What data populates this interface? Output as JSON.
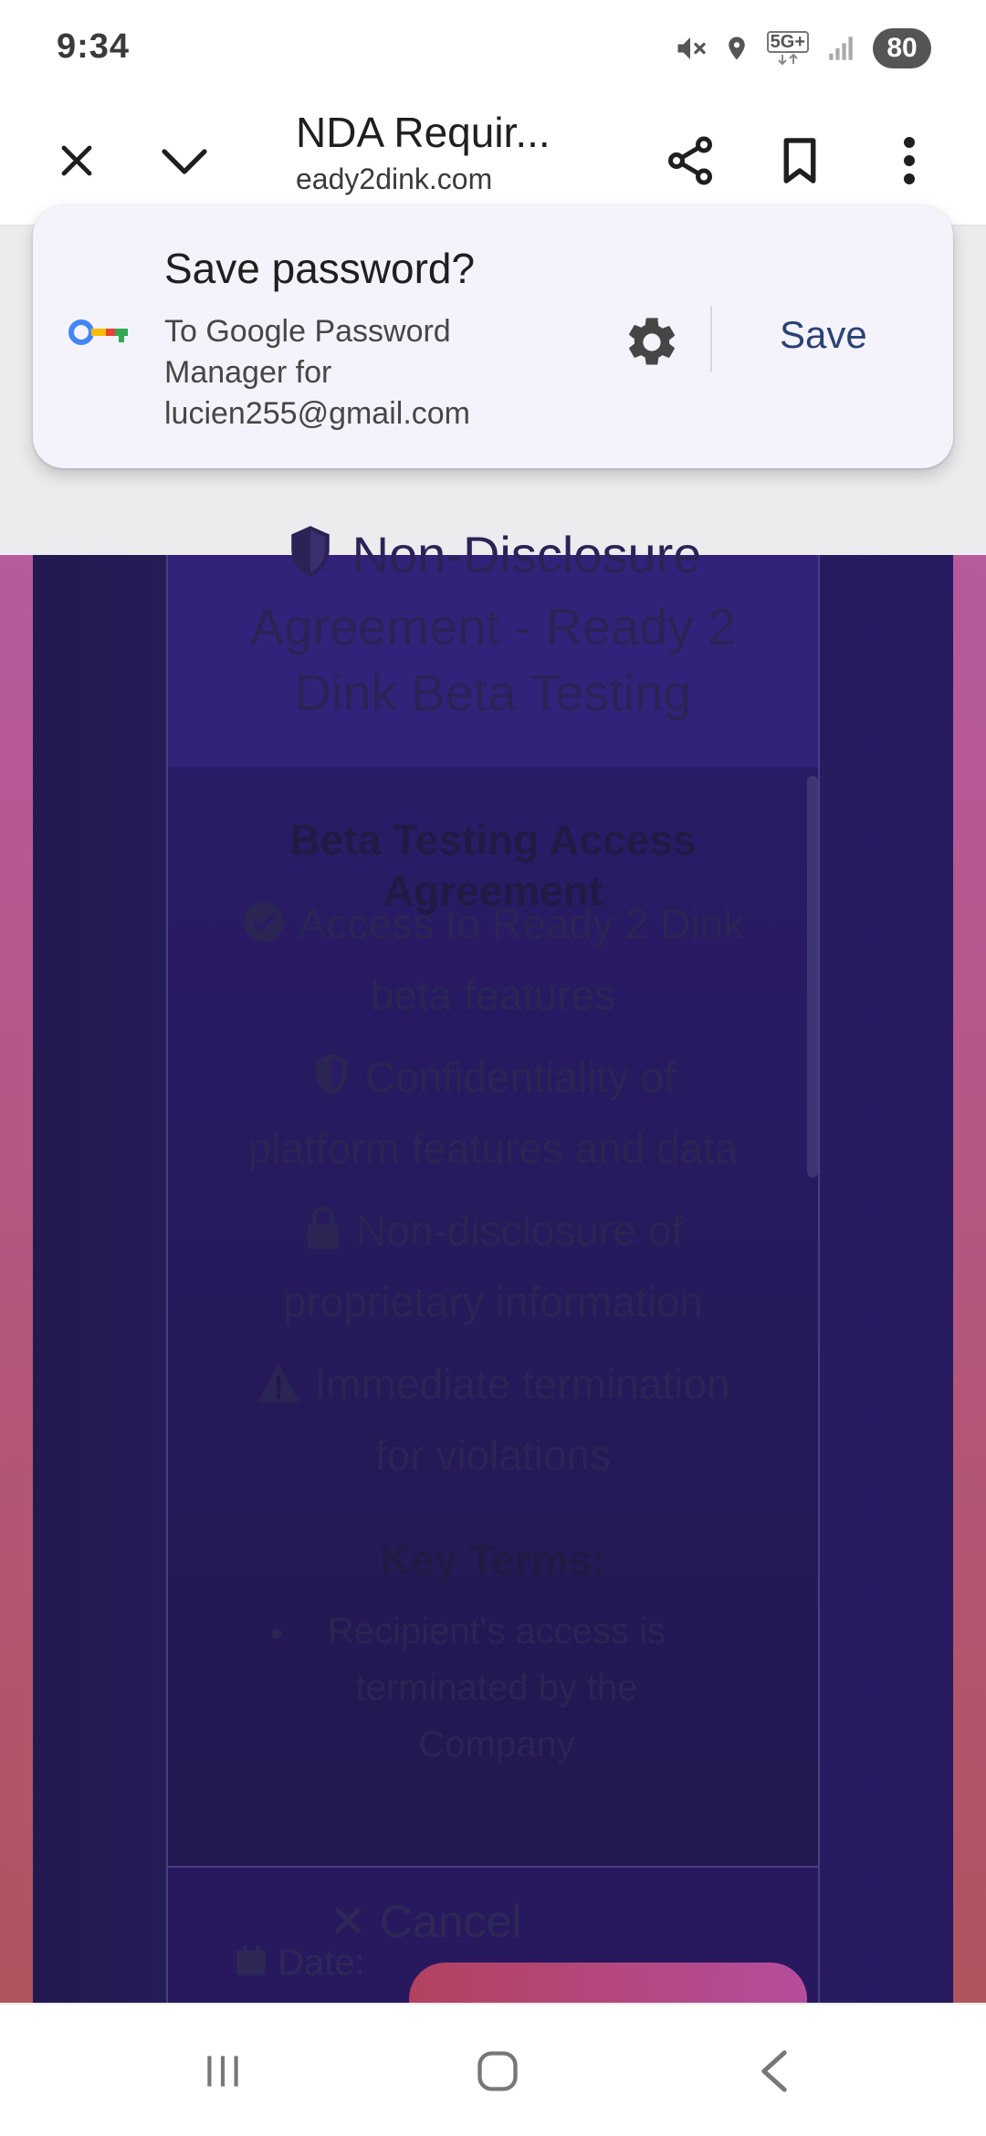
{
  "status_bar": {
    "time": "9:34",
    "network_label": "5G+",
    "battery": "80",
    "icons": [
      "mute-icon",
      "location-icon",
      "network-5g-icon",
      "signal-icon",
      "battery-icon"
    ]
  },
  "toolbar": {
    "title": "NDA Requir...",
    "url": "eady2dink.com",
    "icons": [
      "close-icon",
      "chevron-down-icon",
      "share-icon",
      "bookmark-icon",
      "more-vert-icon"
    ]
  },
  "save_password": {
    "title": "Save password?",
    "subtitle_line1": "To Google Password",
    "subtitle_line2": "Manager for",
    "subtitle_line3": "lucien255@gmail.com",
    "save_label": "Save",
    "icons": [
      "google-key-icon",
      "gear-icon"
    ]
  },
  "page": {
    "header_title_line1": "Non-Disclosure",
    "header_title_line2": "Agreement - Ready 2",
    "header_title_line3": "Dink Beta Testing",
    "section_title_line1": "Beta Testing Access",
    "section_title_line2": "Agreement",
    "features": [
      {
        "line1": "Access to Ready 2 Dink",
        "line2": "beta features",
        "icon": "check-circle-icon"
      },
      {
        "line1": "Confidentiality of",
        "line2": "platform features and data",
        "icon": "shield-icon"
      },
      {
        "line1": "Non-disclosure of",
        "line2": "proprietary information",
        "icon": "lock-icon"
      },
      {
        "line1": "Immediate termination",
        "line2": "for violations",
        "icon": "warning-icon"
      }
    ],
    "key_terms_title": "Key Terms:",
    "bullet": "•",
    "term_line1": "Recipient's access is",
    "term_line2": "terminated by the",
    "term_line3": "Company",
    "cancel_label": "Cancel",
    "date_label": "Date:",
    "colors": {
      "card": "#28195f",
      "card_header": "#33227a",
      "background_pink": "#b75a9e",
      "background_red": "#b0545f",
      "button_gradient_start": "#b3425f",
      "button_gradient_end": "#b54d9c"
    }
  },
  "navbar": {
    "icons": [
      "recent-apps-icon",
      "home-icon",
      "back-icon"
    ]
  }
}
